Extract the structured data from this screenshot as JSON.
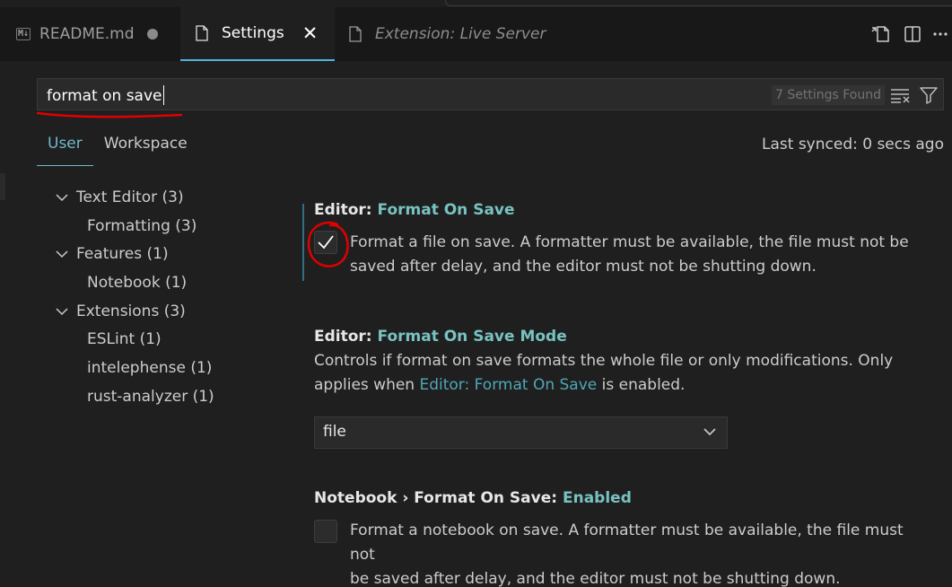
{
  "tabs": [
    {
      "label": "README.md",
      "badge": "M↓",
      "modified": true
    },
    {
      "label": "Settings",
      "active": true
    },
    {
      "label": "Extension: Live Server",
      "preview": true
    }
  ],
  "search": {
    "value": "format on save",
    "results_badge": "7 Settings Found"
  },
  "scope_tabs": [
    "User",
    "Workspace"
  ],
  "last_synced": "Last synced: 0 secs ago",
  "toc": [
    {
      "label": "Text Editor (3)",
      "level": 0,
      "expanded": true
    },
    {
      "label": "Formatting (3)",
      "level": 1
    },
    {
      "label": "Features (1)",
      "level": 0,
      "expanded": true
    },
    {
      "label": "Notebook (1)",
      "level": 1
    },
    {
      "label": "Extensions (3)",
      "level": 0,
      "expanded": true
    },
    {
      "label": "ESLint (1)",
      "level": 1
    },
    {
      "label": "intelephense (1)",
      "level": 1
    },
    {
      "label": "rust-analyzer (1)",
      "level": 1
    }
  ],
  "settings": [
    {
      "category": "Editor: ",
      "name": "Format On Save",
      "checked": true,
      "desc_line1": "Format a file on save. A formatter must be available, the file must not be",
      "desc_line2": "saved after delay, and the editor must not be shutting down."
    },
    {
      "category": "Editor: ",
      "name": "Format On Save Mode",
      "desc_line1": "Controls if format on save formats the whole file or only modifications. Only",
      "desc_pre_link": "applies when ",
      "desc_link": "Editor: Format On Save",
      "desc_post_link": " is enabled.",
      "value": "file"
    },
    {
      "category": "Notebook › Format On Save: ",
      "name": "Enabled",
      "checked": false,
      "desc_line1": "Format a notebook on save. A formatter must be available, the file must not",
      "desc_line2": "be saved after delay, and the editor must not be shutting down."
    }
  ],
  "colors": {
    "accent": "#4fb3d9",
    "setting_name": "#78c3c0",
    "annotation": "#e00000"
  }
}
